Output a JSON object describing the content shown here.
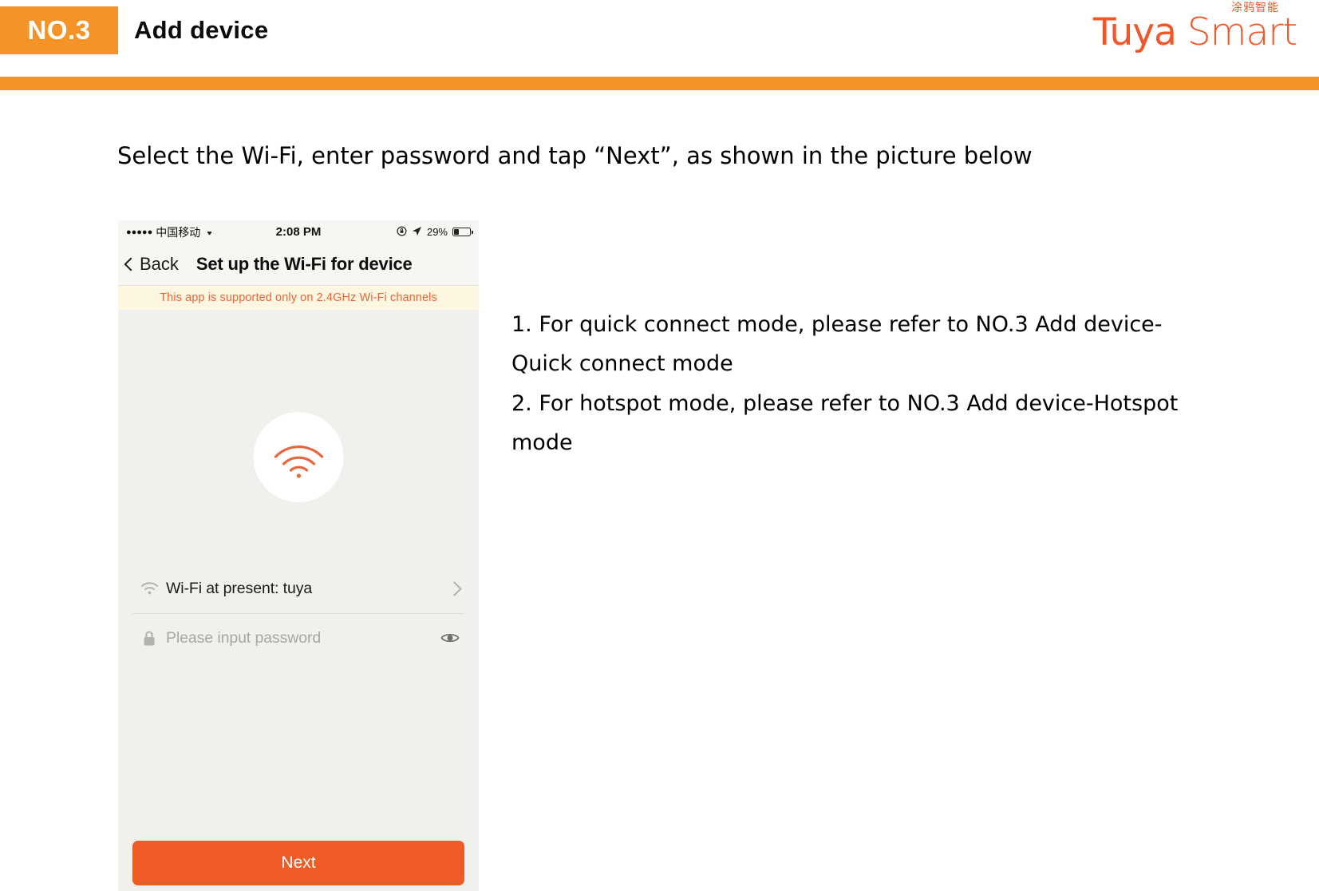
{
  "slide": {
    "badge": "NO.3",
    "title": "Add device",
    "accent_orange": "#F59426",
    "brand_orange": "#F0572A"
  },
  "brand": {
    "cn": "涂鸦智能",
    "name_part1": "Tuya",
    "name_part2": "Smart"
  },
  "instruction": "Select the Wi-Fi, enter password and tap “Next”, as shown in the picture below",
  "phone": {
    "status_bar": {
      "signal_dots": "●●●●●",
      "carrier": "中国移动",
      "wifi_icon": "wifi-icon",
      "time": "2:08 PM",
      "alarm_icon": "alarm-lock-icon",
      "location_icon": "location-arrow-icon",
      "battery_percent": "29%",
      "battery_level": 29
    },
    "nav": {
      "back_label": "Back",
      "title": "Set up the Wi-Fi for device"
    },
    "warning": "This app is supported only on 2.4GHz Wi-Fi channels",
    "hero_icon": "wifi-signal-icon",
    "wifi_row": {
      "icon": "wifi-icon",
      "label": "Wi-Fi at present: tuya",
      "chevron": "chevron-right-icon"
    },
    "password_row": {
      "icon": "lock-icon",
      "placeholder": "Please input password",
      "value": "",
      "toggle_icon": "eye-icon"
    },
    "next_label": "Next",
    "next_color": "#EF5B25",
    "screen_bg": "#F0F0EC",
    "warning_bg": "#FDF6E1",
    "warning_color": "#E8673A"
  },
  "notes": {
    "line1": "1. For quick connect mode, please refer to NO.3 Add device-Quick connect mode",
    "line2": "2. For hotspot mode, please refer to NO.3 Add device-Hotspot mode"
  }
}
